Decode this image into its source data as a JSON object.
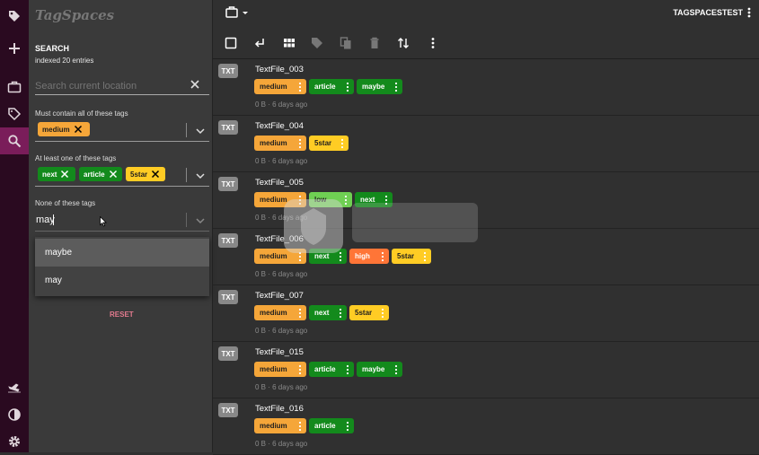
{
  "app": {
    "logo_text": "TagSpaces",
    "location_name": "TAGSPACESTEST",
    "accent_color": "#7a1d5a"
  },
  "rail": {
    "icons": [
      "tag-logo-icon",
      "plus-icon",
      "briefcase-icon",
      "tag-icon",
      "search-icon",
      "airplane-icon",
      "contrast-icon",
      "gear-icon"
    ],
    "active": "search-icon"
  },
  "search": {
    "title": "SEARCH",
    "status": "indexed 20 entries",
    "placeholder": "Search current location",
    "must_label": "Must contain all of these tags",
    "must_tags": [
      "medium"
    ],
    "atleast_label": "At least one of these tags",
    "atleast_tags": [
      "next",
      "article",
      "5star"
    ],
    "none_label": "None of these tags",
    "none_input": "may",
    "suggestions": [
      "maybe",
      "may"
    ],
    "reset_label": "RESET"
  },
  "tag_colors": {
    "medium": "#f5a639",
    "article": "#138a1c",
    "maybe": "#138a1c",
    "next": "#138a1c",
    "5star": "#ffcc24",
    "low": "#6fd053",
    "high": "#ff7537"
  },
  "toolbar": {
    "icons": [
      "select-all-checkbox-icon",
      "parent-folder-icon",
      "grid-view-icon",
      "tag-selected-icon",
      "copy-icon",
      "delete-icon",
      "sort-icon",
      "more-options-icon"
    ]
  },
  "files": [
    {
      "type": "TXT",
      "name": "TextFile_003",
      "tags": [
        "medium",
        "article",
        "maybe"
      ],
      "meta": "0 B · 6 days ago"
    },
    {
      "type": "TXT",
      "name": "TextFile_004",
      "tags": [
        "medium",
        "5star"
      ],
      "meta": "0 B · 6 days ago"
    },
    {
      "type": "TXT",
      "name": "TextFile_005",
      "tags": [
        "medium",
        "low",
        "next"
      ],
      "meta": "0 B · 6 days ago"
    },
    {
      "type": "TXT",
      "name": "TextFile_006",
      "tags": [
        "medium",
        "next",
        "high",
        "5star"
      ],
      "meta": "0 B · 6 days ago"
    },
    {
      "type": "TXT",
      "name": "TextFile_007",
      "tags": [
        "medium",
        "next",
        "5star"
      ],
      "meta": "0 B · 6 days ago"
    },
    {
      "type": "TXT",
      "name": "TextFile_015",
      "tags": [
        "medium",
        "article",
        "maybe"
      ],
      "meta": "0 B · 6 days ago"
    },
    {
      "type": "TXT",
      "name": "TextFile_016",
      "tags": [
        "medium",
        "article"
      ],
      "meta": "0 B · 6 days ago"
    }
  ]
}
